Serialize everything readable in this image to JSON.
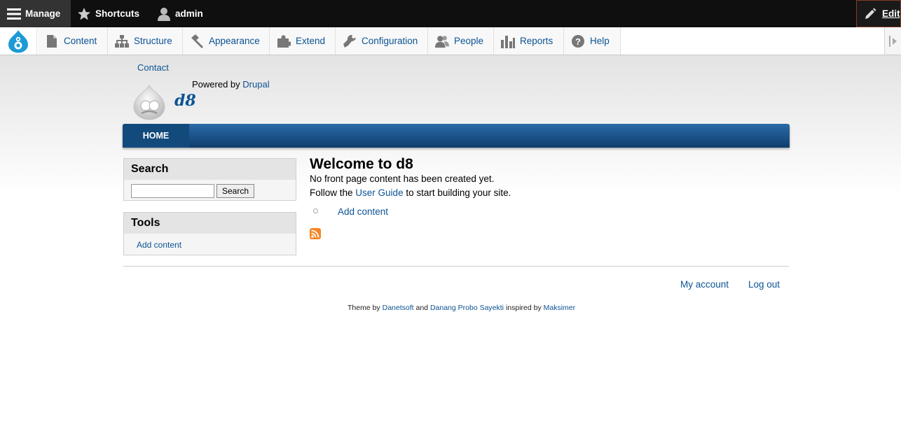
{
  "toolbar": {
    "manage": "Manage",
    "shortcuts": "Shortcuts",
    "user": "admin",
    "edit": "Edit"
  },
  "tray": {
    "items": [
      {
        "label": "Content",
        "icon": "file-icon"
      },
      {
        "label": "Structure",
        "icon": "sitemap-icon"
      },
      {
        "label": "Appearance",
        "icon": "paintbrush-icon"
      },
      {
        "label": "Extend",
        "icon": "puzzle-icon"
      },
      {
        "label": "Configuration",
        "icon": "wrench-icon"
      },
      {
        "label": "People",
        "icon": "people-icon"
      },
      {
        "label": "Reports",
        "icon": "bar-chart-icon"
      },
      {
        "label": "Help",
        "icon": "help-icon"
      }
    ]
  },
  "header": {
    "contact": "Contact",
    "powered_prefix": "Powered by",
    "powered_link": "Drupal",
    "site_name": "d8"
  },
  "nav": {
    "home": "HOME"
  },
  "sidebar": {
    "search_title": "Search",
    "search_button": "Search",
    "search_value": "",
    "tools_title": "Tools",
    "tools_link": "Add content"
  },
  "main": {
    "title": "Welcome to d8",
    "line1": "No front page content has been created yet.",
    "line2_prefix": "Follow the",
    "line2_link": "User Guide",
    "line2_suffix": "to start building your site.",
    "add_content": "Add content"
  },
  "footer": {
    "my_account": "My account",
    "log_out": "Log out",
    "credit_prefix": "Theme by",
    "credit_link1": "Danetsoft",
    "credit_and": "and",
    "credit_link2": "Danang Probo Sayekti",
    "credit_inspired": "inspired by",
    "credit_link3": "Maksimer"
  },
  "colors": {
    "link": "#0b5394",
    "nav_blue": "#134a7c",
    "toolbar": "#0f0f0f",
    "rss": "#f78422"
  }
}
